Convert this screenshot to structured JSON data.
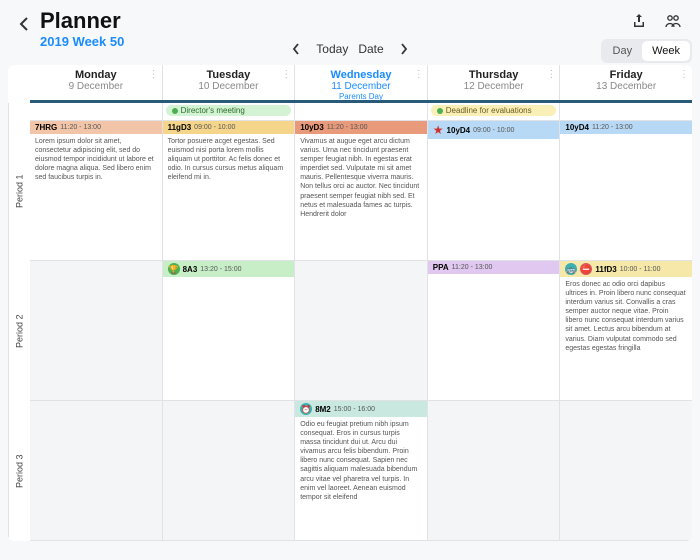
{
  "header": {
    "title": "Planner",
    "subtitle": "2019 Week 50",
    "today_label": "Today",
    "date_label": "Date",
    "view_day": "Day",
    "view_week": "Week"
  },
  "days": [
    {
      "name": "Monday",
      "date": "9 December",
      "today": false
    },
    {
      "name": "Tuesday",
      "date": "10 December",
      "today": false
    },
    {
      "name": "Wednesday",
      "date": "11 December",
      "sub": "Parents Day",
      "today": true
    },
    {
      "name": "Thursday",
      "date": "12 December",
      "today": false
    },
    {
      "name": "Friday",
      "date": "13 December",
      "today": false
    }
  ],
  "periods": [
    "Period 1",
    "Period 2",
    "Period 3"
  ],
  "banners": {
    "tue": {
      "label": "Director's meeting",
      "type": "green"
    },
    "thu": {
      "label": "Deadline for evaluations",
      "type": "yellow"
    }
  },
  "p1": {
    "mon": {
      "code": "7HRG",
      "time": "11:20 - 13:00",
      "bg": "bg-pink",
      "body": "Lorem ipsum dolor sit amet, consectetur adipiscing elit, sed do eiusmod tempor incididunt ut labore et dolore magna aliqua. Sed libero enim sed faucibus turpis in."
    },
    "tue": {
      "code": "11gD3",
      "time": "09:00 - 10:00",
      "bg": "bg-orange",
      "body": "Tortor posuere acget egestas. Sed euismod nisi porta lorem mollis aliquam ut porttitor. Ac felis donec et odio. In cursus cursus metus aliquam eleifend mi in."
    },
    "wed": {
      "code": "10yD3",
      "time": "11:20 - 13:00",
      "bg": "bg-red",
      "body": "Vivamus at augue eget arcu dictum varius. Urna nec tincidunt praesent semper feugiat nibh. In egestas erat imperdiet sed. Vulputate mi sit amet mauris. Pellentesque viverra mauris. Non tellus orci ac auctor. Nec tincidunt praesent semper feugiat nibh sed. Et netus et malesuada fames ac turpis. Hendrerit dolor"
    },
    "thu": {
      "code": "10yD4",
      "time": "09:00 - 10:00",
      "bg": "bg-blue",
      "star": true
    },
    "fri": {
      "code": "10yD4",
      "time": "11:20 - 13:00",
      "bg": "bg-blue"
    }
  },
  "p2": {
    "tue": {
      "code": "8A3",
      "time": "13:20 - 15:00",
      "bg": "bg-green",
      "icon": "trophy"
    },
    "thu": {
      "code": "PPA",
      "time": "11:20 - 13:00",
      "bg": "bg-purple"
    },
    "fri": {
      "code": "11fD3",
      "time": "10:00 - 11:00",
      "bg": "bg-yellow",
      "icons": "double",
      "body": "Eros donec ac odio orci dapibus ultrices in. Proin libero nunc consequat interdum varius sit. Convallis a cras semper auctor neque vitae. Proin libero nunc consequat interdum varius sit amet. Lectus arcu bibendum at varius. Diam vulputat commodo sed egestas egestas fringilla"
    }
  },
  "p3": {
    "wed": {
      "code": "8M2",
      "time": "15:00 - 16:00",
      "bg": "bg-teal",
      "icon": "clock",
      "body": "Odio eu feugiat pretium nibh ipsum consequat. Eros in cursus turpis massa tincidunt dui ut. Arcu dui vivamus arcu felis bibendum. Proin libero nunc consequat. Sapien nec sagittis aliquam malesuada bibendum arcu vitae vel pharetra vel turpis. In enim vel laoreet. Aenean euismod tempor sit eleifend"
    }
  }
}
